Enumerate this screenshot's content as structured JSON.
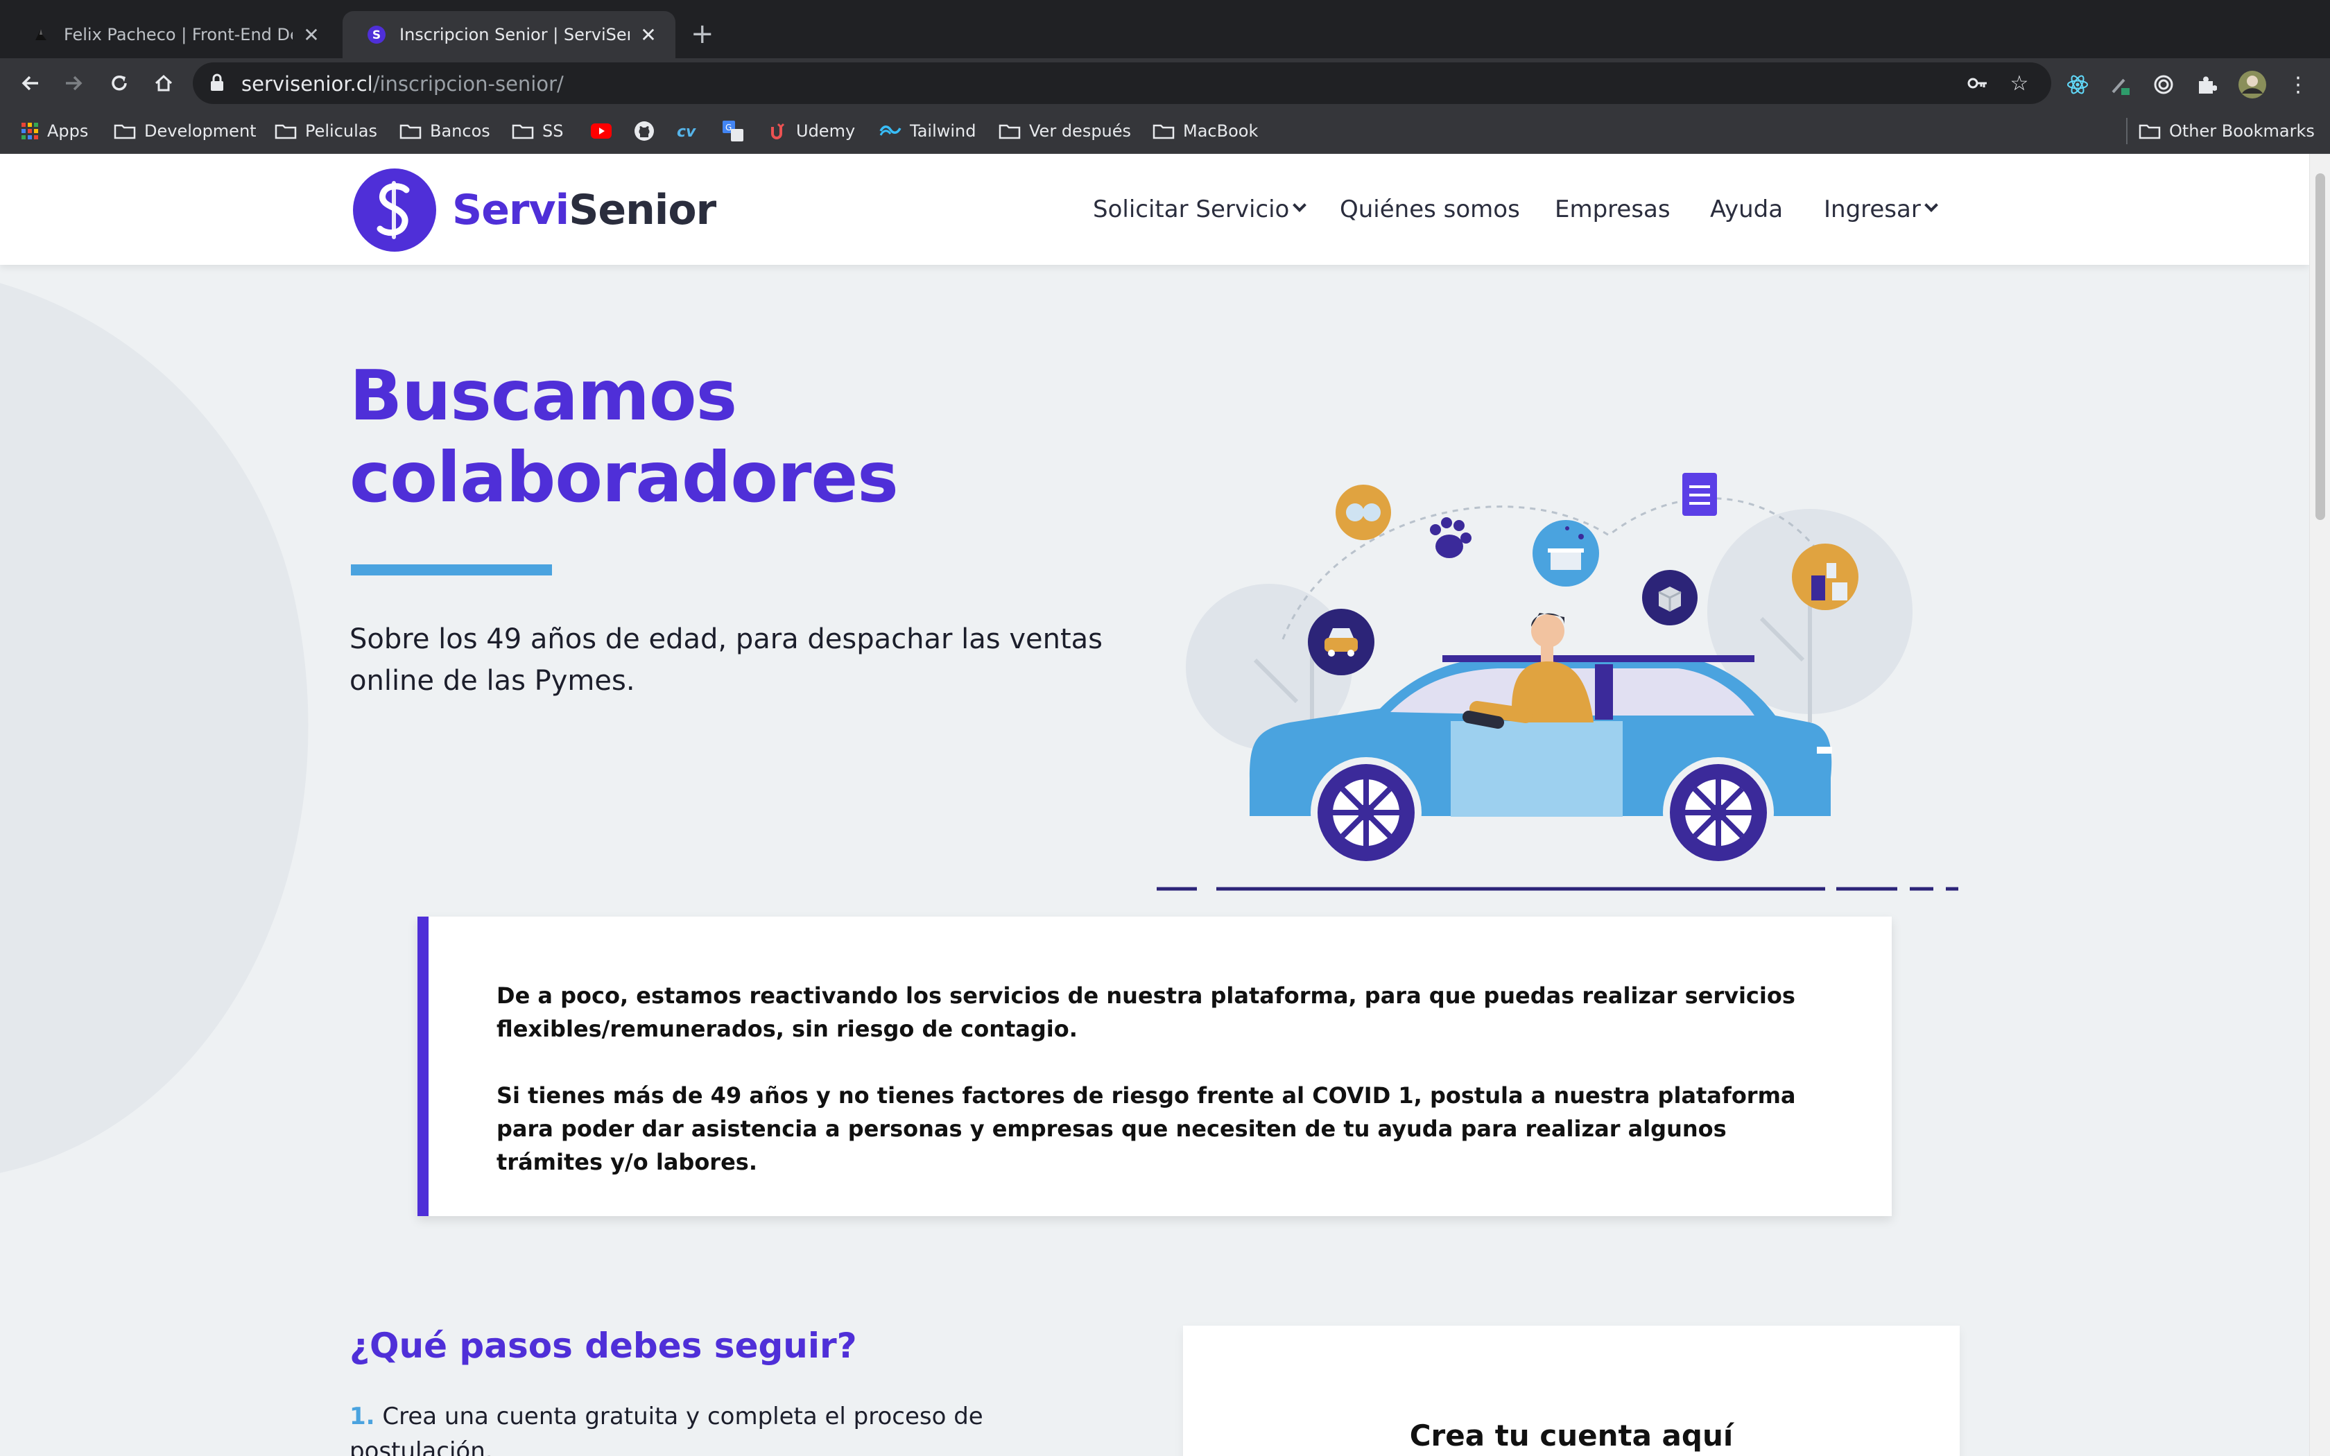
{
  "browser": {
    "tabs": [
      {
        "title": "Felix Pacheco | Front-End Developer",
        "active": false
      },
      {
        "title": "Inscripcion Senior | ServiSenior",
        "active": true
      }
    ],
    "url_host": "servisenior.cl",
    "url_path": "/inscripcion-senior/",
    "bookmarks": [
      "Apps",
      "Development",
      "Peliculas",
      "Bancos",
      "SS",
      "Udemy",
      "Tailwind",
      "Ver después",
      "MacBook"
    ],
    "other_bookmarks": "Other Bookmarks"
  },
  "site": {
    "logo": {
      "part1": "Servi",
      "part2": "Senior"
    },
    "nav": {
      "solicitar": "Solicitar Servicio",
      "quienes": "Quiénes somos",
      "empresas": "Empresas",
      "ayuda": "Ayuda",
      "ingresar": "Ingresar"
    },
    "hero": {
      "title_line1": "Buscamos",
      "title_line2": "colaboradores",
      "subtitle": "Sobre los 49 años de edad, para despachar las ventas online de las Pymes."
    },
    "notice": {
      "p1": "De a poco, estamos reactivando los servicios de nuestra plataforma, para que puedas realizar servicios flexibles/remunerados, sin riesgo de contagio.",
      "p2": "Si tienes más de 49 años y no tienes factores de riesgo frente al COVID 1, postula a nuestra plataforma para poder dar asistencia a personas y empresas que necesiten de tu ayuda para realizar algunos trámites y/o labores."
    },
    "steps": {
      "title": "¿Qué pasos debes seguir?",
      "step1_num": "1.",
      "step1_text": "Crea una cuenta gratuita y completa el proceso de postulación."
    },
    "signup": {
      "title": "Crea tu cuenta aquí"
    }
  },
  "colors": {
    "brand": "#4f2fd8",
    "accent": "#4aa3df",
    "dark": "#2a2d3d"
  }
}
